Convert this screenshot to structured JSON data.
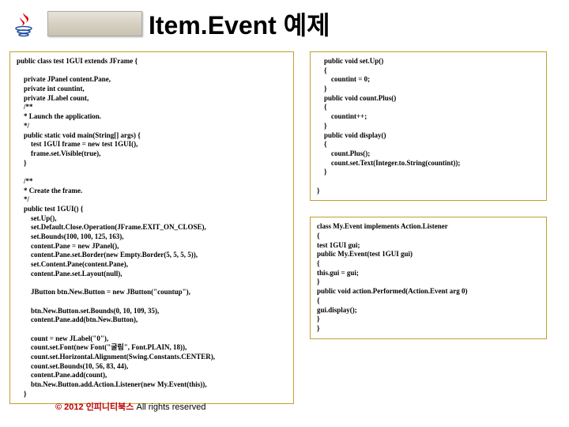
{
  "title": "Item.Event 예제",
  "code_left": "public class test 1GUI extends JFrame {\n\n    private JPanel content.Pane,\n    private int countint,\n    private JLabel count,\n    /**\n    * Launch the application.\n    */\n    public static void main(String[] args) {\n        test 1GUI frame = new test 1GUI(),\n        frame.set.Visible(true),\n    }\n\n    /**\n    * Create the frame.\n    */\n    public test 1GUI() {\n        set.Up(),\n        set.Default.Close.Operation(JFrame.EXIT_ON_CLOSE),\n        set.Bounds(100, 100, 125, 163),\n        content.Pane = new JPanel(),\n        content.Pane.set.Border(new Empty.Border(5, 5, 5, 5)),\n        set.Content.Pane(content.Pane),\n        content.Pane.set.Layout(null),\n\n        JButton btn.New.Button = new JButton(\"countup\"),\n\n        btn.New.Button.set.Bounds(0, 10, 109, 35),\n        content.Pane.add(btn.New.Button),\n\n        count = new JLabel(\"0\"),\n        count.set.Font(new Font(\"굴림\", Font.PLAIN, 18)),\n        count.set.Horizontal.Alignment(Swing.Constants.CENTER),\n        count.set.Bounds(10, 56, 83, 44),\n        content.Pane.add(count),\n        btn.New.Button.add.Action.Listener(new My.Event(this)),\n    }",
  "code_right_1": "    public void set.Up()\n    {\n        countint = 0;\n    }\n    public void count.Plus()\n    {\n        countint++;\n    }\n    public void display()\n    {\n        count.Plus();\n        count.set.Text(Integer.to.String(countint));\n    }\n\n}",
  "code_right_2": "class My.Event implements Action.Listener\n{\ntest 1GUI gui;\npublic My.Event(test 1GUI gui)\n{\nthis.gui = gui;\n}\npublic void action.Performed(Action.Event arg 0)\n{\ngui.display();\n}\n}",
  "footer": {
    "copy": "© 2012 인피니티북스",
    "rights": "  All rights reserved"
  }
}
